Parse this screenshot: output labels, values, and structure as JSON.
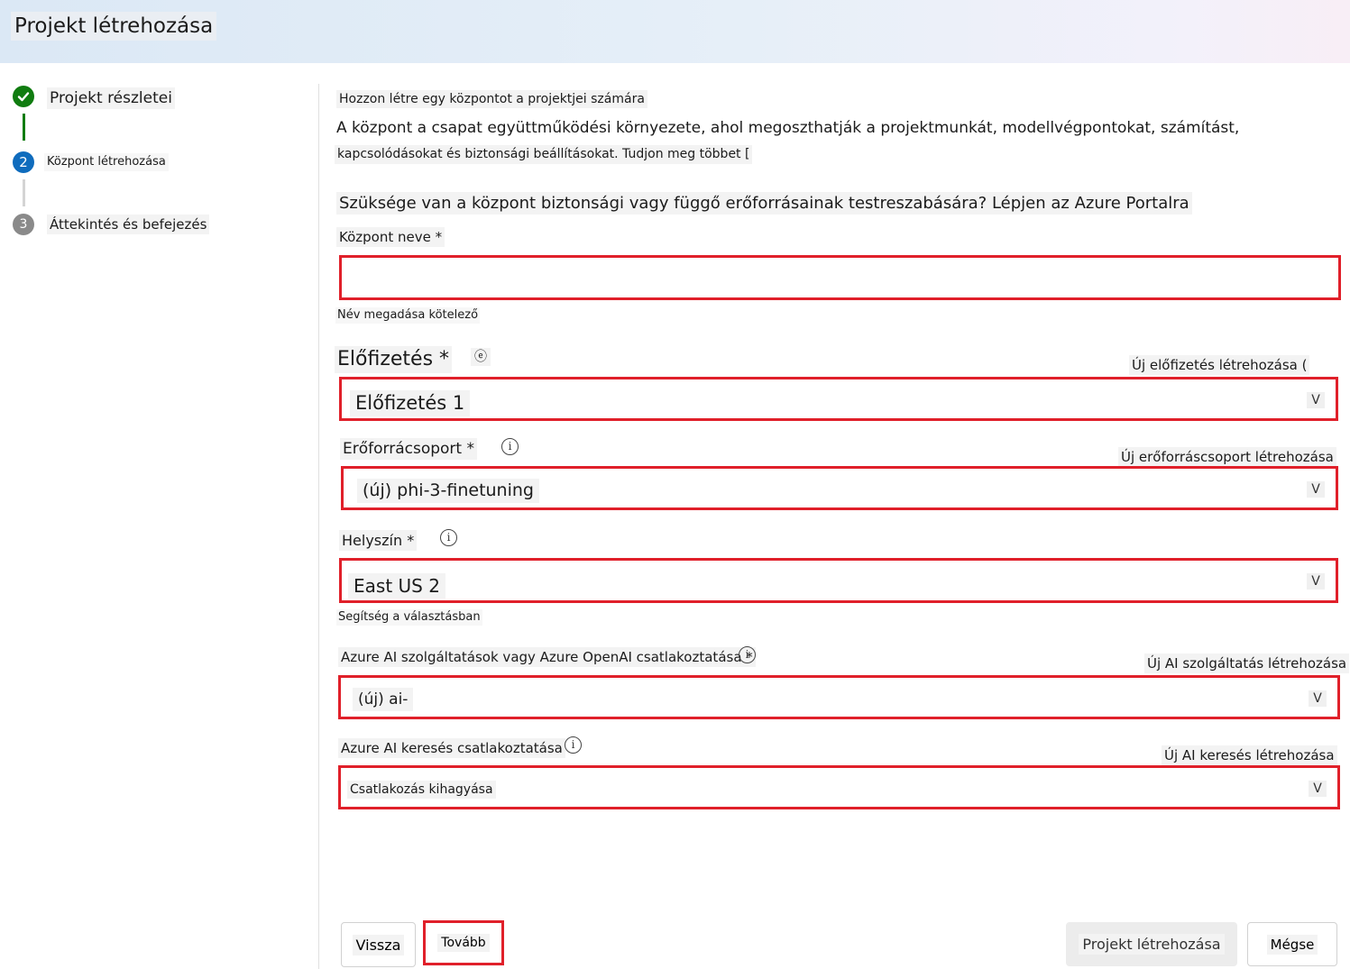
{
  "header": {
    "title": "Projekt létrehozása"
  },
  "steps": [
    {
      "label": "Projekt részletei",
      "icon": "check-icon",
      "status": "done"
    },
    {
      "label": "Központ létrehozása",
      "number": "2",
      "status": "active"
    },
    {
      "label": "Áttekintés és befejezés",
      "number": "3",
      "status": "pending"
    }
  ],
  "intro": {
    "heading": "Hozzon létre egy központot a projektjei számára",
    "description": "A központ a csapat együttműködési környezete, ahol megoszthatják a projektmunkát, modellvégpontokat, számítást,",
    "description2": "kapcsolódásokat és biztonsági beállításokat. Tudjon meg többet [",
    "customize": "Szüksége van a központ biztonsági vagy függő erőforrásainak testreszabására? Lépjen az Azure Portalra"
  },
  "hub_name": {
    "label": "Központ neve *",
    "value": "",
    "error": "Név megadása kötelező"
  },
  "subscription": {
    "label": "Előfizetés *",
    "icon_glyph": "ⓔ",
    "create_link": "Új előfizetés létrehozása (",
    "value": "Előfizetés 1"
  },
  "resource_group": {
    "label": "Erőforrácsoport *",
    "create_link": "Új erőforráscsoport létrehozása",
    "value": "(új) phi-3-finetuning"
  },
  "location": {
    "label": "Helyszín *",
    "value": "East US 2",
    "help": "Segítség a választásban"
  },
  "ai_services": {
    "label": "Azure AI szolgáltatások vagy Azure OpenAI csatlakoztatása *",
    "create_link": "Új AI szolgáltatás létrehozása",
    "value": "(új) ai-"
  },
  "ai_search": {
    "label": "Azure AI keresés csatlakoztatása",
    "create_link": "Új AI keresés létrehozása",
    "value": "Csatlakozás kihagyása"
  },
  "chevron_glyph": "V",
  "info_glyph": "i",
  "footer": {
    "back": "Vissza",
    "next": "Tovább",
    "create": "Projekt létrehozása",
    "cancel": "Mégse"
  },
  "colors": {
    "accent": "#0f6cbd",
    "success": "#107c10",
    "highlight": "#e0202a"
  }
}
